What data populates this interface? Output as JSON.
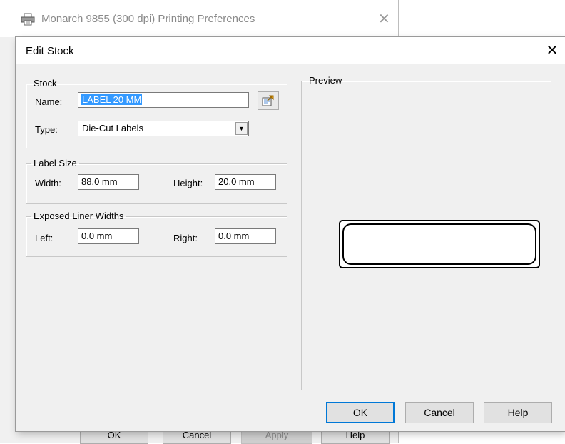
{
  "background_window": {
    "title": "Monarch 9855 (300 dpi) Printing Preferences",
    "close_glyph": "✕",
    "buttons": [
      "OK",
      "Cancel",
      "Apply",
      "Help"
    ]
  },
  "dialog": {
    "title": "Edit Stock",
    "close_glyph": "✕"
  },
  "stock": {
    "legend": "Stock",
    "name_label": "Name:",
    "name_value": "LABEL 20 MM",
    "type_label": "Type:",
    "type_value": "Die-Cut Labels",
    "combo_arrow_glyph": "▼"
  },
  "label_size": {
    "legend": "Label Size",
    "width_label": "Width:",
    "width_value": "88.0 mm",
    "height_label": "Height:",
    "height_value": "20.0 mm"
  },
  "liner": {
    "legend": "Exposed Liner Widths",
    "left_label": "Left:",
    "left_value": "0.0 mm",
    "right_label": "Right:",
    "right_value": "0.0 mm"
  },
  "preview": {
    "legend": "Preview"
  },
  "buttons": {
    "ok": "OK",
    "cancel": "Cancel",
    "help": "Help"
  },
  "colors": {
    "selection": "#3399ff",
    "dialog_bg": "#f0f0f0",
    "default_button_border": "#0078d7"
  },
  "icons": {
    "printer": "printer-icon",
    "stock_properties": "stock-properties-icon"
  }
}
